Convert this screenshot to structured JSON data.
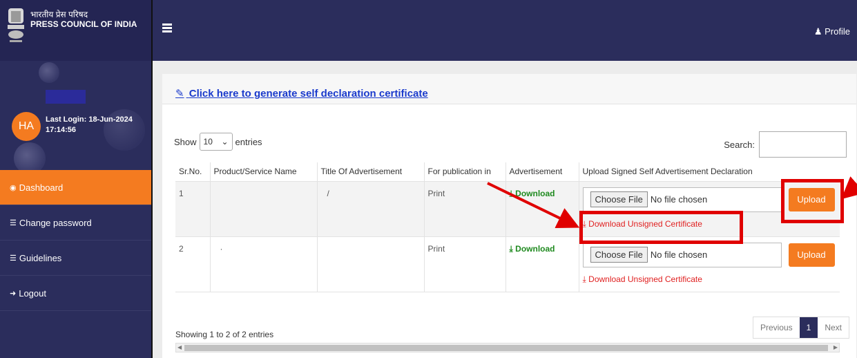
{
  "brand": {
    "hindi": "भारतीय प्रेस परिषद",
    "english": "PRESS COUNCIL OF INDIA"
  },
  "user": {
    "initials": "HA",
    "last_login_label": "Last Login: 18-Jun-2024",
    "last_login_time": "17:14:56"
  },
  "sidebar": {
    "items": [
      {
        "icon": "dashboard-icon",
        "label": "Dashboard",
        "active": true
      },
      {
        "icon": "list-icon",
        "label": "Change password"
      },
      {
        "icon": "list-icon",
        "label": "Guidelines"
      },
      {
        "icon": "logout-icon",
        "label": "Logout"
      }
    ]
  },
  "topbar": {
    "profile_label": "Profile"
  },
  "main": {
    "generate_link": "Click here to generate self declaration certificate",
    "show_label": "Show",
    "entries_value": "10",
    "entries_label": "entries",
    "search_label": "Search:"
  },
  "table": {
    "headers": [
      "Sr.No.",
      "Product/Service Name",
      "Title Of Advertisement",
      "For publication in",
      "Advertisement",
      "Upload Signed Self Advertisement Declaration"
    ],
    "rows": [
      {
        "sr": "1",
        "product": "",
        "title": "/",
        "publication": "Print",
        "download": "Download",
        "choose": "Choose File",
        "no_file": "No file chosen",
        "upload": "Upload",
        "unsigned": "Download Unsigned Certificate"
      },
      {
        "sr": "2",
        "product": "·",
        "title": "",
        "publication": "Print",
        "download": "Download",
        "choose": "Choose File",
        "no_file": "No file chosen",
        "upload": "Upload",
        "unsigned": "Download Unsigned Certificate"
      }
    ]
  },
  "footer": {
    "info": "Showing 1 to 2 of 2 entries",
    "previous": "Previous",
    "page": "1",
    "next": "Next"
  },
  "colors": {
    "navy": "#2b2d5c",
    "accent": "#f47b20",
    "annotation": "#e00000"
  }
}
